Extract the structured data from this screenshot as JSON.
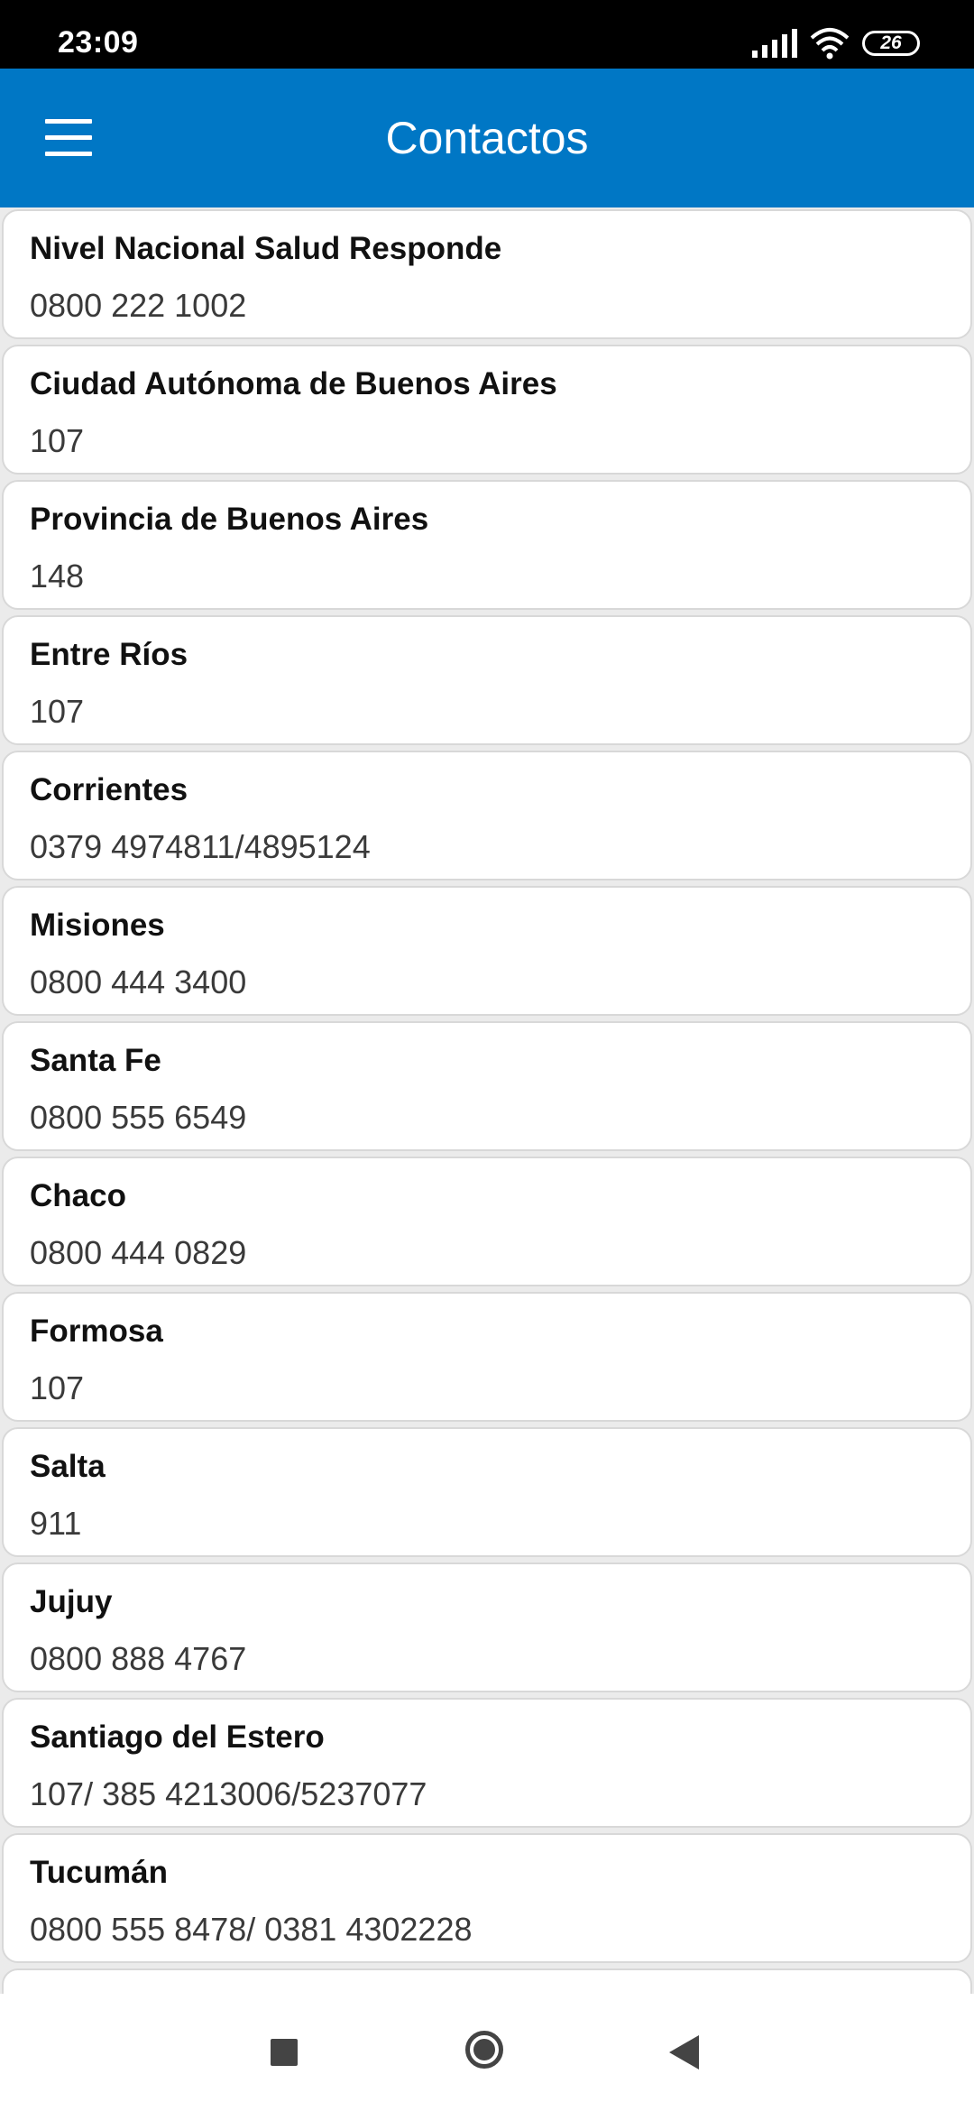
{
  "status_bar": {
    "time": "23:09",
    "battery": "26"
  },
  "app_bar": {
    "title": "Contactos"
  },
  "contacts": [
    {
      "name": "Nivel Nacional Salud Responde",
      "phone": "0800 222 1002"
    },
    {
      "name": "Ciudad Autónoma de Buenos Aires",
      "phone": "107"
    },
    {
      "name": "Provincia de Buenos Aires",
      "phone": "148"
    },
    {
      "name": "Entre Ríos",
      "phone": "107"
    },
    {
      "name": "Corrientes",
      "phone": "0379 4974811/4895124"
    },
    {
      "name": "Misiones",
      "phone": "0800 444 3400"
    },
    {
      "name": "Santa Fe",
      "phone": "0800 555 6549"
    },
    {
      "name": "Chaco",
      "phone": "0800 444 0829"
    },
    {
      "name": "Formosa",
      "phone": "107"
    },
    {
      "name": "Salta",
      "phone": "911"
    },
    {
      "name": "Jujuy",
      "phone": "0800 888 4767"
    },
    {
      "name": "Santiago del Estero",
      "phone": "107/ 385 4213006/5237077"
    },
    {
      "name": "Tucumán",
      "phone": "0800 555 8478/ 0381 4302228"
    }
  ],
  "icons": {
    "menu": "hamburger-menu-icon",
    "signal": "cell-signal-icon",
    "wifi": "wifi-icon",
    "battery": "battery-icon",
    "nav_recents": "square-recents-icon",
    "nav_home": "circle-home-icon",
    "nav_back": "triangle-back-icon"
  },
  "colors": {
    "app_bar": "#0077c5",
    "status_bar": "#000000",
    "background": "#ebebeb"
  }
}
